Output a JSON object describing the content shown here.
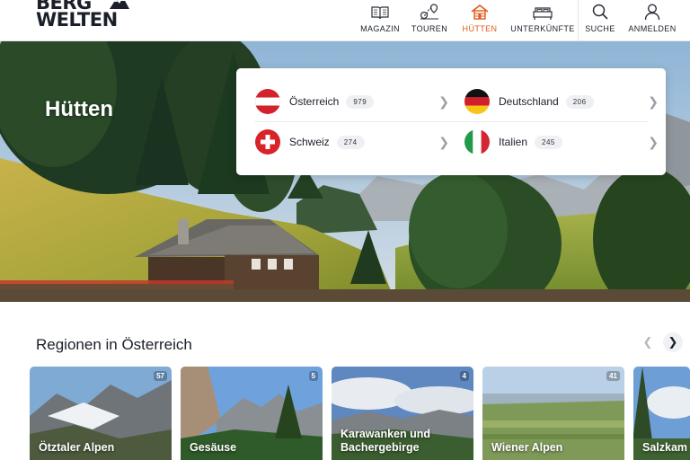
{
  "brand": {
    "line1": "BERG",
    "line2": "WELTEN"
  },
  "nav": [
    {
      "label": "MAGAZIN",
      "icon": "book-icon",
      "active": false
    },
    {
      "label": "TOUREN",
      "icon": "route-icon",
      "active": false
    },
    {
      "label": "HÜTTEN",
      "icon": "hut-icon",
      "active": true
    },
    {
      "label": "UNTERKÜNFTE",
      "icon": "bed-icon",
      "active": false
    },
    {
      "label": "SUCHE",
      "icon": "search-icon",
      "active": false
    },
    {
      "label": "ANMELDEN",
      "icon": "user-icon",
      "active": false
    }
  ],
  "hero": {
    "title": "Hütten"
  },
  "countries": [
    {
      "name": "Österreich",
      "count": "979",
      "flag": "austria-flag-icon"
    },
    {
      "name": "Deutschland",
      "count": "206",
      "flag": "germany-flag-icon"
    },
    {
      "name": "Schweiz",
      "count": "274",
      "flag": "switzerland-flag-icon"
    },
    {
      "name": "Italien",
      "count": "245",
      "flag": "italy-flag-icon"
    }
  ],
  "regions_section": {
    "title": "Regionen in Österreich"
  },
  "regions": [
    {
      "name": "Ötztaler Alpen",
      "count": "57"
    },
    {
      "name": "Gesäuse",
      "count": "5"
    },
    {
      "name": "Karawanken und Bachergebirge",
      "count": "4"
    },
    {
      "name": "Wiener Alpen",
      "count": "41"
    },
    {
      "name": "Salzkam",
      "count": ""
    }
  ],
  "colors": {
    "accent": "#e05a1c",
    "text": "#1b1f2a"
  }
}
